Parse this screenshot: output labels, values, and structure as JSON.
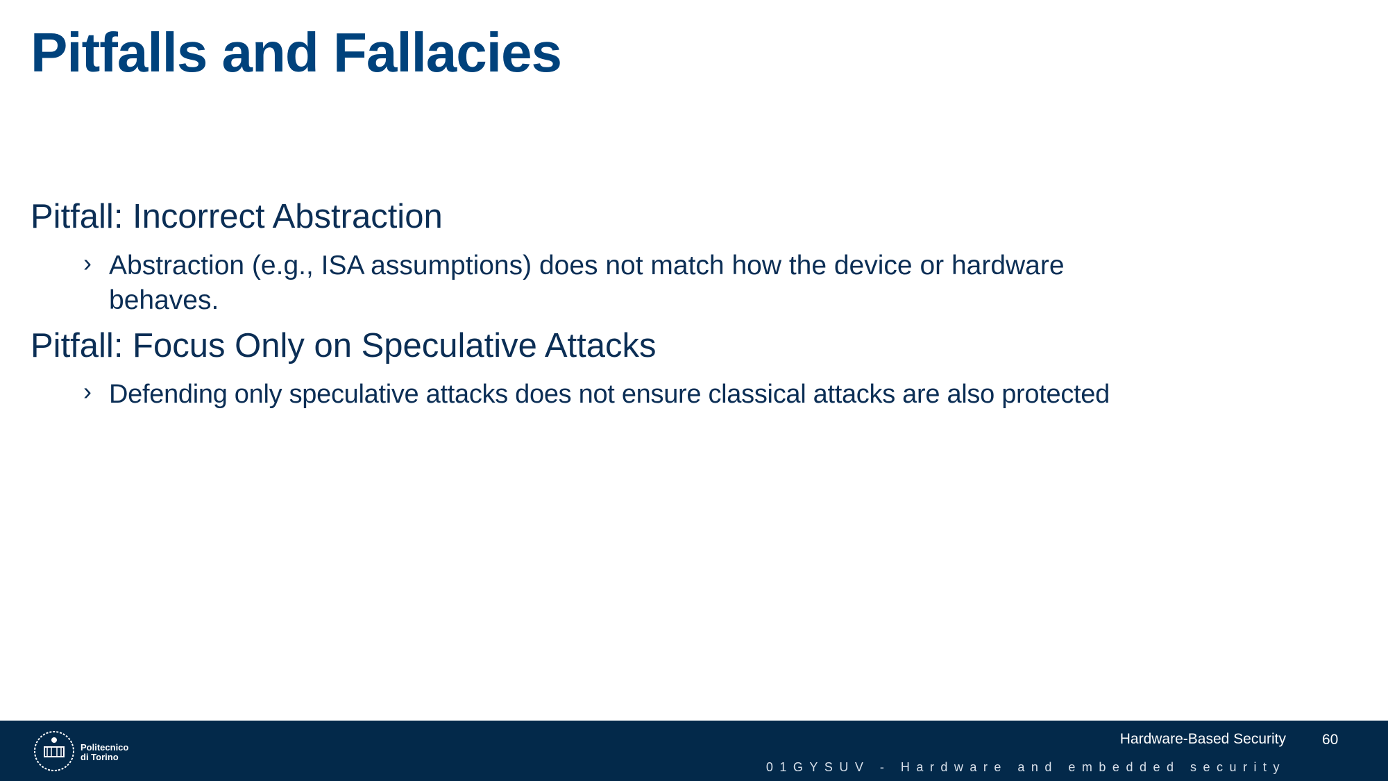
{
  "slide": {
    "title": "Pitfalls and Fallacies",
    "items": [
      {
        "heading": "Pitfall: Incorrect Abstraction",
        "bullets": [
          {
            "marker": "›",
            "lines": [
              "Abstraction (e.g., ISA assumptions) does not match how the device or hardware",
              "behaves."
            ]
          }
        ]
      },
      {
        "heading": "Pitfall: Focus Only on Speculative Attacks",
        "bullets": [
          {
            "marker": "›",
            "lines": [
              "Defending only speculative attacks does not ensure  classical attacks are also protected"
            ]
          }
        ]
      }
    ]
  },
  "footer": {
    "logo_text": [
      "Politecnico",
      "di Torino"
    ],
    "course_title": "Hardware-Based Security",
    "page_number": "60",
    "course_code": "01GYSUV - Hardware and embedded security",
    "background_color": "#03294a"
  }
}
